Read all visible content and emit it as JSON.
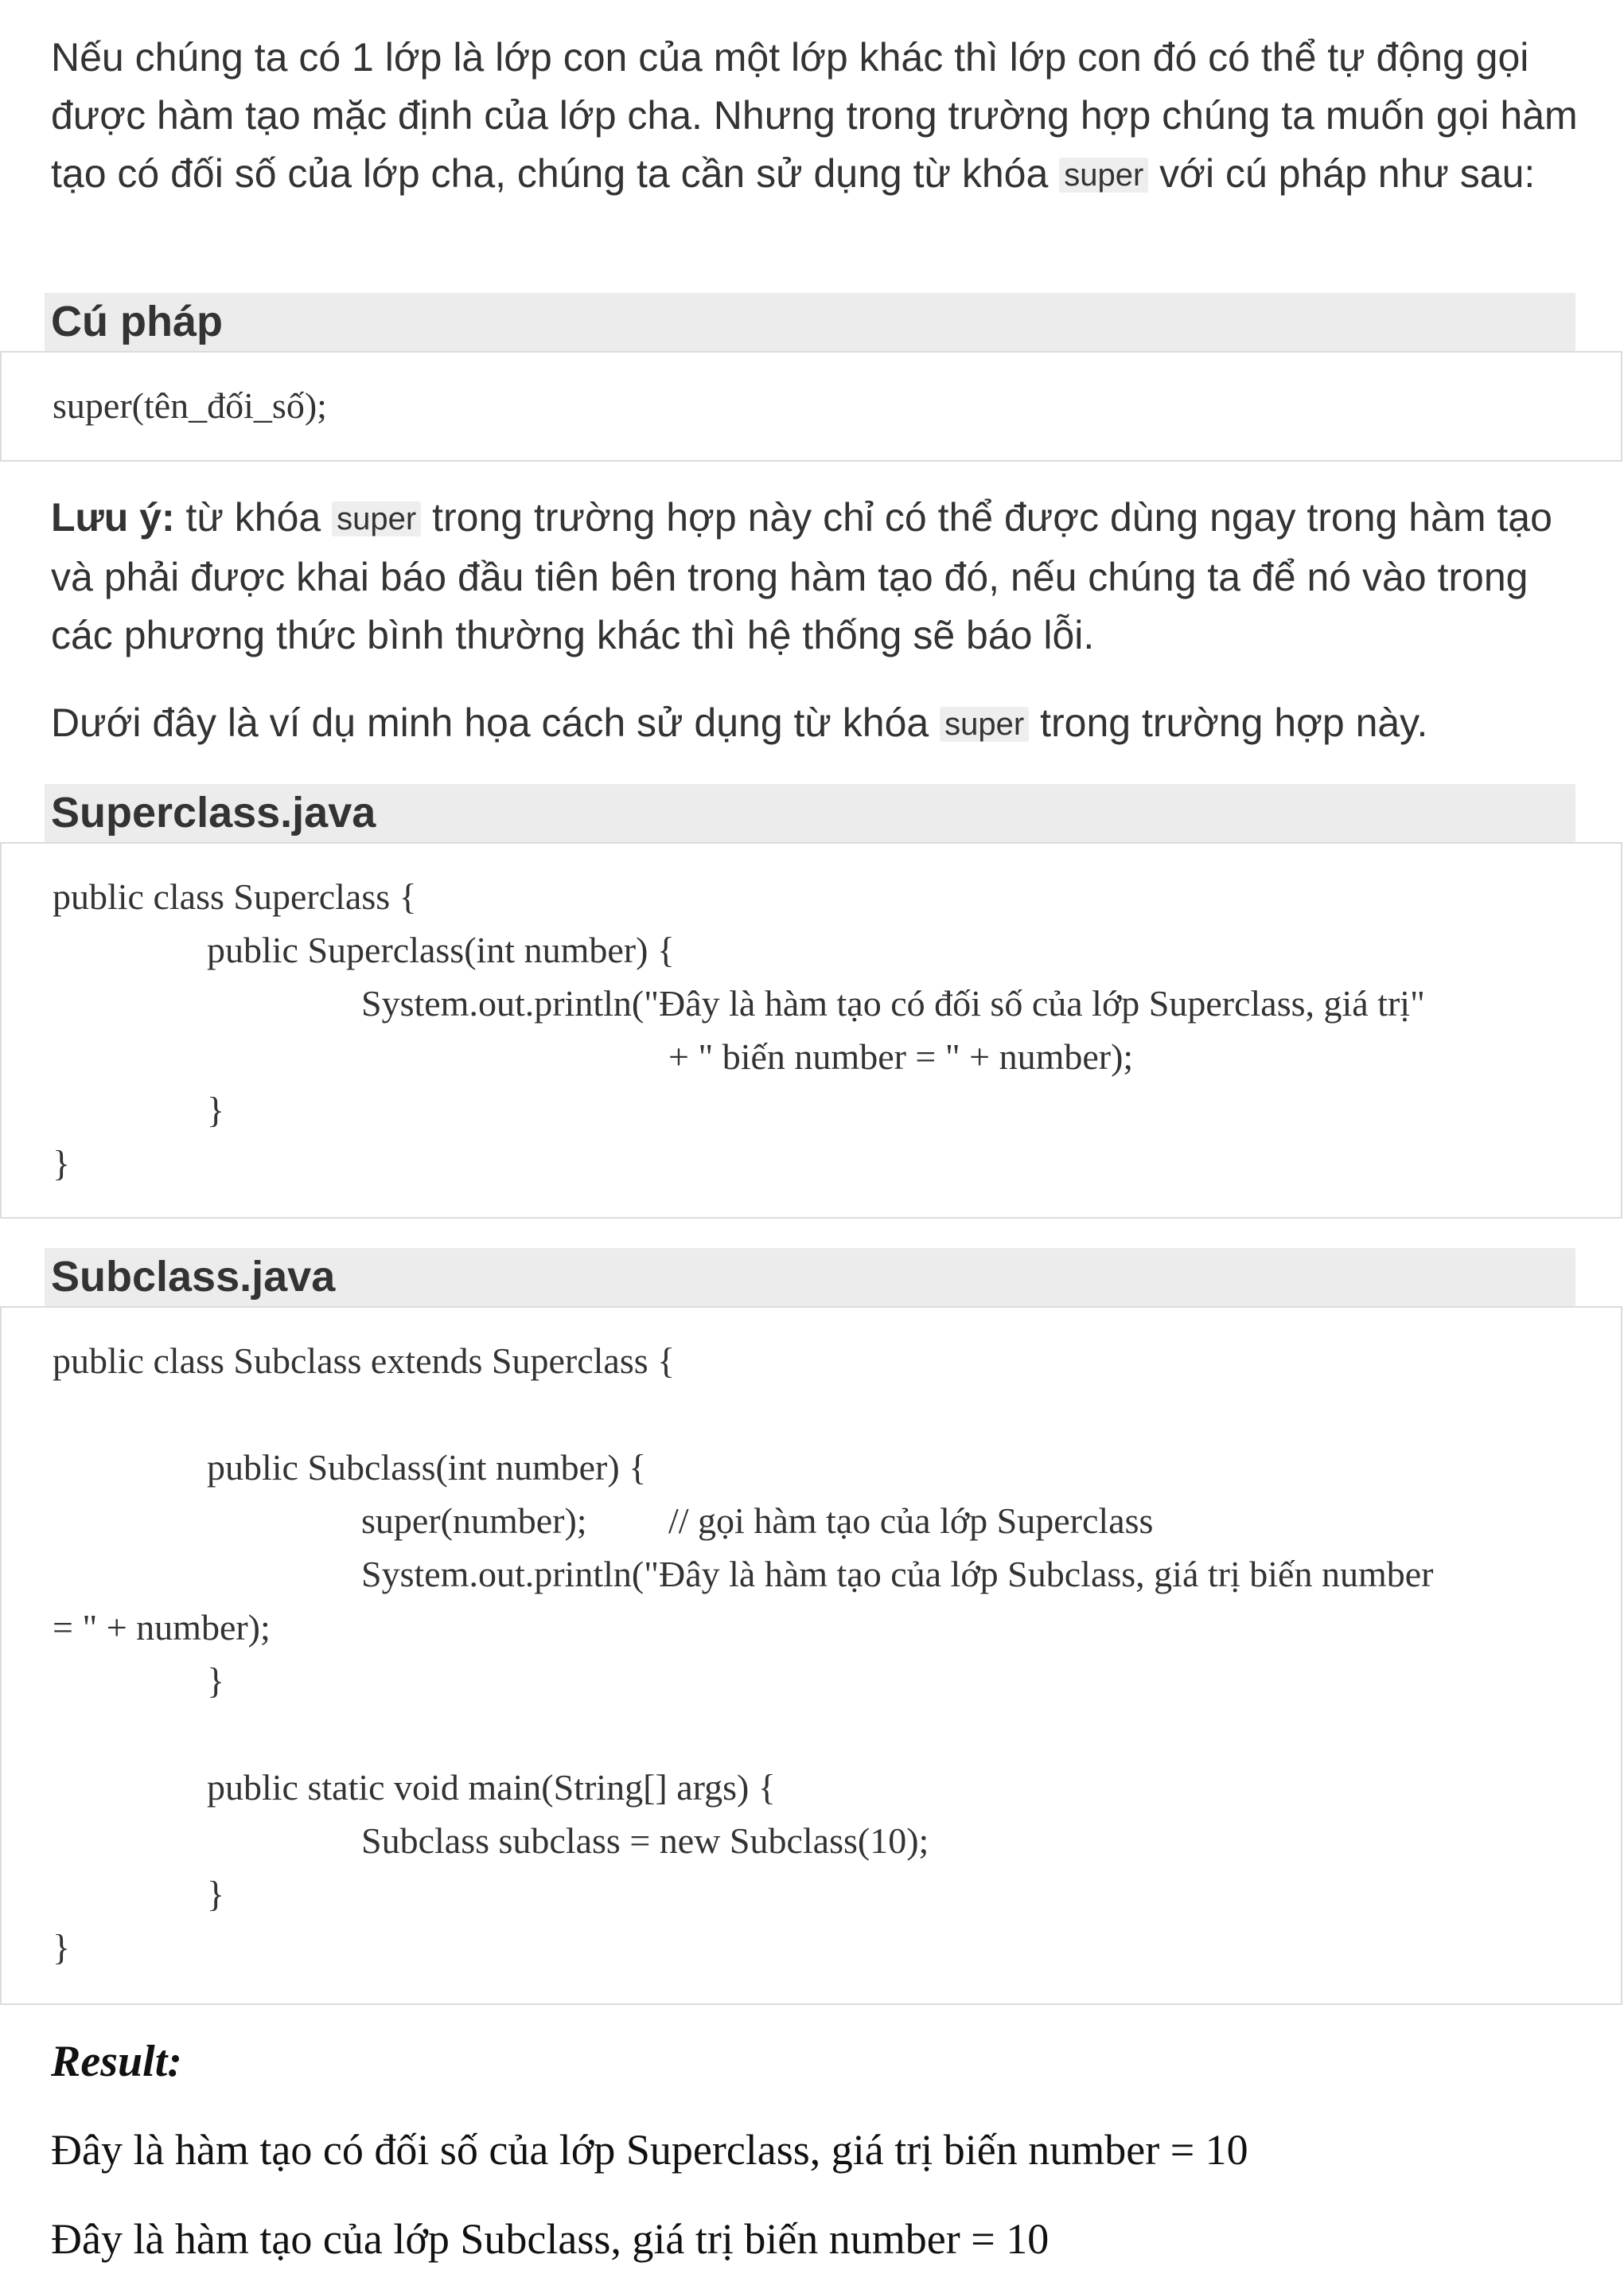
{
  "intro": {
    "text_before": "Nếu chúng ta có 1 lớp là lớp con của một lớp khác thì lớp con đó có thể tự động gọi được hàm tạo mặc định của lớp cha. Nhưng trong trường hợp chúng ta muốn gọi hàm tạo có đối số của lớp cha, chúng ta cần sử dụng từ khóa",
    "keyword": "super",
    "text_after": "với cú pháp như sau:"
  },
  "syntax": {
    "header": "Cú pháp",
    "code": "super(tên_đối_số);"
  },
  "note": {
    "label": "Lưu ý:",
    "text_before": "từ khóa",
    "keyword": "super",
    "text_after": "trong trường hợp này chỉ có thể được dùng ngay trong hàm tạo và phải được khai báo đầu tiên bên trong hàm tạo đó, nếu chúng ta để nó vào trong các phương thức bình thường khác thì hệ thống sẽ báo lỗi."
  },
  "example_intro": {
    "text_before": "Dưới đây là ví dụ minh họa cách sử dụng từ khóa",
    "keyword": "super",
    "text_after": "trong trường hợp này."
  },
  "superclass": {
    "header": "Superclass.java",
    "lines": [
      "public class Superclass {",
      "public Superclass(int number) {",
      "System.out.println(\"Đây là hàm tạo có đối số của lớp Superclass, giá trị\"",
      "+ \" biến number = \" + number);",
      "}",
      "}"
    ]
  },
  "subclass": {
    "header": "Subclass.java",
    "lines": [
      "public class Subclass extends Superclass {",
      "public Subclass(int number) {",
      "super(number);",
      "// gọi hàm tạo của lớp Superclass",
      "System.out.println(\"Đây là hàm tạo của lớp Subclass, giá trị biến number",
      "= \" + number);",
      "}",
      "public static void main(String[] args) {",
      "Subclass subclass = new Subclass(10);",
      "}",
      "}"
    ]
  },
  "result": {
    "label": "Result:",
    "lines": [
      "Đây là hàm tạo có đối số của lớp Superclass, giá trị biến number = 10",
      "Đây là hàm tạo của lớp Subclass, giá trị biến number = 10"
    ]
  }
}
